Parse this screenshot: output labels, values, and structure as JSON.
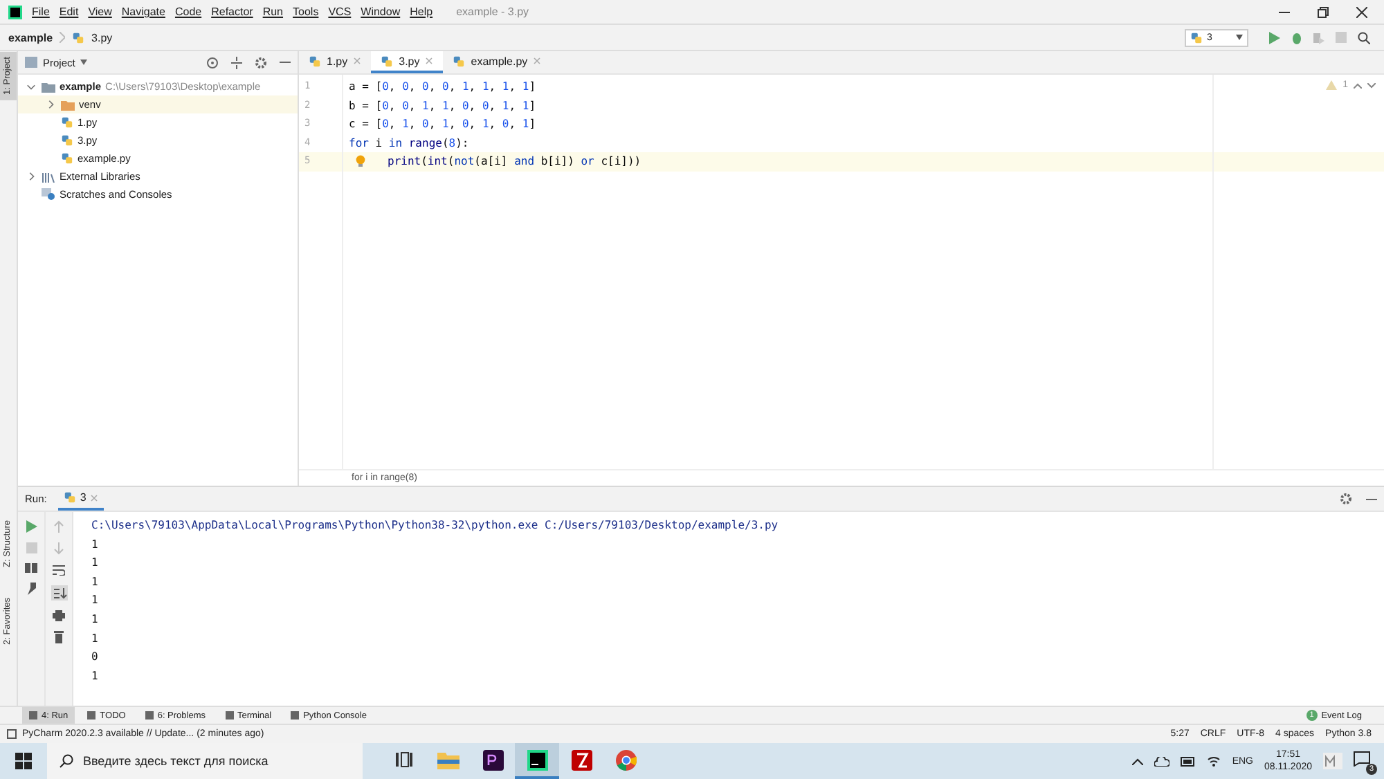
{
  "window": {
    "title": "example - 3.py"
  },
  "menu": [
    "File",
    "Edit",
    "View",
    "Navigate",
    "Code",
    "Refactor",
    "Run",
    "Tools",
    "VCS",
    "Window",
    "Help"
  ],
  "navbar": {
    "breadcrumb": [
      "example",
      "3.py"
    ],
    "run_config": "3"
  },
  "left_stripe": [
    {
      "label": "1: Project",
      "selected": true
    },
    {
      "label": "Z: Structure",
      "selected": false
    },
    {
      "label": "2: Favorites",
      "selected": false
    }
  ],
  "project": {
    "title": "Project",
    "tree": [
      {
        "label": "example",
        "path": "C:\\Users\\79103\\Desktop\\example",
        "kind": "project",
        "expanded": true,
        "selected": false,
        "children": [
          {
            "label": "venv",
            "kind": "folder",
            "expanded": false,
            "selected": true
          },
          {
            "label": "1.py",
            "kind": "file",
            "selected": false
          },
          {
            "label": "3.py",
            "kind": "file",
            "selected": false
          },
          {
            "label": "example.py",
            "kind": "file",
            "selected": false
          }
        ]
      },
      {
        "label": "External Libraries",
        "kind": "library",
        "expanded": false,
        "selected": false
      },
      {
        "label": "Scratches and Consoles",
        "kind": "scratches",
        "selected": false
      }
    ]
  },
  "editor": {
    "tabs": [
      {
        "label": "1.py",
        "selected": false
      },
      {
        "label": "3.py",
        "selected": true
      },
      {
        "label": "example.py",
        "selected": false
      }
    ],
    "warnings": "1",
    "lines": [
      {
        "number": "1",
        "current": false,
        "tokens": [
          {
            "text": "a = [",
            "kind": "plain"
          },
          {
            "text": "0",
            "kind": "number"
          },
          {
            "text": ", ",
            "kind": "plain"
          },
          {
            "text": "0",
            "kind": "number"
          },
          {
            "text": ", ",
            "kind": "plain"
          },
          {
            "text": "0",
            "kind": "number"
          },
          {
            "text": ", ",
            "kind": "plain"
          },
          {
            "text": "0",
            "kind": "number"
          },
          {
            "text": ", ",
            "kind": "plain"
          },
          {
            "text": "1",
            "kind": "number"
          },
          {
            "text": ", ",
            "kind": "plain"
          },
          {
            "text": "1",
            "kind": "number"
          },
          {
            "text": ", ",
            "kind": "plain"
          },
          {
            "text": "1",
            "kind": "number"
          },
          {
            "text": ", ",
            "kind": "plain"
          },
          {
            "text": "1",
            "kind": "number"
          },
          {
            "text": "]",
            "kind": "plain"
          }
        ]
      },
      {
        "number": "2",
        "current": false,
        "tokens": [
          {
            "text": "b = [",
            "kind": "plain"
          },
          {
            "text": "0",
            "kind": "number"
          },
          {
            "text": ", ",
            "kind": "plain"
          },
          {
            "text": "0",
            "kind": "number"
          },
          {
            "text": ", ",
            "kind": "plain"
          },
          {
            "text": "1",
            "kind": "number"
          },
          {
            "text": ", ",
            "kind": "plain"
          },
          {
            "text": "1",
            "kind": "number"
          },
          {
            "text": ", ",
            "kind": "plain"
          },
          {
            "text": "0",
            "kind": "number"
          },
          {
            "text": ", ",
            "kind": "plain"
          },
          {
            "text": "0",
            "kind": "number"
          },
          {
            "text": ", ",
            "kind": "plain"
          },
          {
            "text": "1",
            "kind": "number"
          },
          {
            "text": ", ",
            "kind": "plain"
          },
          {
            "text": "1",
            "kind": "number"
          },
          {
            "text": "]",
            "kind": "plain"
          }
        ]
      },
      {
        "number": "3",
        "current": false,
        "tokens": [
          {
            "text": "c = [",
            "kind": "plain"
          },
          {
            "text": "0",
            "kind": "number"
          },
          {
            "text": ", ",
            "kind": "plain"
          },
          {
            "text": "1",
            "kind": "number"
          },
          {
            "text": ", ",
            "kind": "plain"
          },
          {
            "text": "0",
            "kind": "number"
          },
          {
            "text": ", ",
            "kind": "plain"
          },
          {
            "text": "1",
            "kind": "number"
          },
          {
            "text": ", ",
            "kind": "plain"
          },
          {
            "text": "0",
            "kind": "number"
          },
          {
            "text": ", ",
            "kind": "plain"
          },
          {
            "text": "1",
            "kind": "number"
          },
          {
            "text": ", ",
            "kind": "plain"
          },
          {
            "text": "0",
            "kind": "number"
          },
          {
            "text": ", ",
            "kind": "plain"
          },
          {
            "text": "1",
            "kind": "number"
          },
          {
            "text": "]",
            "kind": "plain"
          }
        ]
      },
      {
        "number": "4",
        "current": false,
        "tokens": [
          {
            "text": "for",
            "kind": "keyword"
          },
          {
            "text": " i ",
            "kind": "plain"
          },
          {
            "text": "in",
            "kind": "keyword"
          },
          {
            "text": " range",
            "kind": "builtin"
          },
          {
            "text": "(",
            "kind": "plain"
          },
          {
            "text": "8",
            "kind": "number"
          },
          {
            "text": "):",
            "kind": "plain"
          }
        ]
      },
      {
        "number": "5",
        "current": true,
        "bulb": true,
        "tokens": [
          {
            "text": "print",
            "kind": "builtin"
          },
          {
            "text": "(",
            "kind": "plain"
          },
          {
            "text": "int",
            "kind": "builtin"
          },
          {
            "text": "(",
            "kind": "plain"
          },
          {
            "text": "not",
            "kind": "keyword"
          },
          {
            "text": "(a[i] ",
            "kind": "plain"
          },
          {
            "text": "and",
            "kind": "keyword"
          },
          {
            "text": " b[i]) ",
            "kind": "plain"
          },
          {
            "text": "or",
            "kind": "keyword"
          },
          {
            "text": " c[i]))",
            "kind": "plain"
          }
        ]
      }
    ],
    "breadcrumb": "for i in range(8)"
  },
  "run": {
    "label": "Run:",
    "tab": "3",
    "console": [
      {
        "text": "C:\\Users\\79103\\AppData\\Local\\Programs\\Python\\Python38-32\\python.exe C:/Users/79103/Desktop/example/3.py",
        "kind": "command"
      },
      {
        "text": "1",
        "kind": "output"
      },
      {
        "text": "1",
        "kind": "output"
      },
      {
        "text": "1",
        "kind": "output"
      },
      {
        "text": "1",
        "kind": "output"
      },
      {
        "text": "1",
        "kind": "output"
      },
      {
        "text": "1",
        "kind": "output"
      },
      {
        "text": "0",
        "kind": "output"
      },
      {
        "text": "1",
        "kind": "output"
      }
    ]
  },
  "tool_tabs": [
    {
      "label": "4: Run",
      "selected": true
    },
    {
      "label": "TODO",
      "selected": false
    },
    {
      "label": "6: Problems",
      "selected": false
    },
    {
      "label": "Terminal",
      "selected": false
    },
    {
      "label": "Python Console",
      "selected": false
    }
  ],
  "event_log": {
    "label": "Event Log",
    "count": "1"
  },
  "status_bar": {
    "message": "PyCharm 2020.2.3 available // Update... (2 minutes ago)",
    "items": [
      "5:27",
      "CRLF",
      "UTF-8",
      "4 spaces",
      "Python 3.8"
    ]
  },
  "taskbar": {
    "search_placeholder": "Введите здесь текст для поиска",
    "apps": [
      {
        "kind": "taskview",
        "selected": false
      },
      {
        "kind": "explorer",
        "selected": false
      },
      {
        "kind": "premiere",
        "selected": false
      },
      {
        "kind": "pycharm",
        "selected": true
      },
      {
        "kind": "filezilla",
        "selected": false
      },
      {
        "kind": "chrome",
        "selected": false
      }
    ],
    "language": "ENG",
    "time": "17:51",
    "date": "08.11.2020",
    "notifications": "3"
  }
}
